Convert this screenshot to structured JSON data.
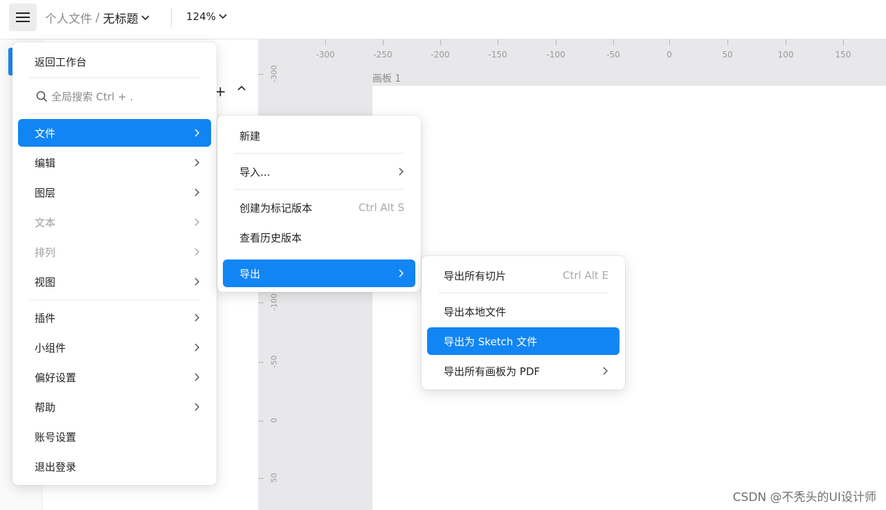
{
  "topbar": {
    "breadcrumb_parent": "个人文件",
    "breadcrumb_sep": "/",
    "breadcrumb_current": "无标题",
    "zoom": "124%"
  },
  "canvas": {
    "artboard_label": "画板 1",
    "hruler": [
      "-300",
      "-250",
      "-200",
      "-150",
      "-100",
      "-50",
      "0",
      "50",
      "100",
      "150"
    ],
    "vruler": [
      "-300",
      "-100",
      "-50",
      "0",
      "50"
    ]
  },
  "main_menu": {
    "back": "返回工作台",
    "search_placeholder": "全局搜索 Ctrl + .",
    "items": [
      {
        "label": "文件"
      },
      {
        "label": "编辑"
      },
      {
        "label": "图层"
      },
      {
        "label": "文本"
      },
      {
        "label": "排列"
      },
      {
        "label": "视图"
      },
      {
        "label": "插件"
      },
      {
        "label": "小组件"
      },
      {
        "label": "偏好设置"
      },
      {
        "label": "帮助"
      },
      {
        "label": "账号设置"
      },
      {
        "label": "退出登录"
      }
    ]
  },
  "file_menu": {
    "items": [
      {
        "label": "新建"
      },
      {
        "label": "导入..."
      },
      {
        "label": "创建为标记版本",
        "shortcut": "Ctrl Alt S"
      },
      {
        "label": "查看历史版本"
      },
      {
        "label": "导出"
      }
    ]
  },
  "export_menu": {
    "items": [
      {
        "label": "导出所有切片",
        "shortcut": "Ctrl Alt E"
      },
      {
        "label": "导出本地文件"
      },
      {
        "label": "导出为 Sketch 文件"
      },
      {
        "label": "导出所有画板为 PDF"
      }
    ]
  },
  "watermark": "CSDN @不秃头的UI设计师",
  "colors": {
    "accent": "#1285f4",
    "canvas": "#e8e8ea"
  }
}
